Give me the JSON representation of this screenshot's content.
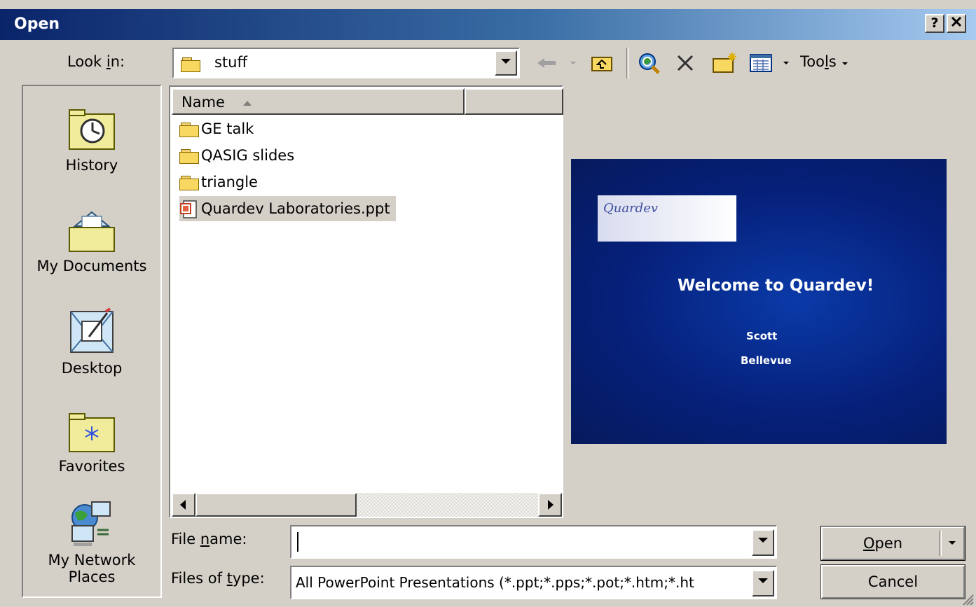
{
  "window": {
    "title": "Open",
    "help_btn": "?",
    "close_btn": "✕"
  },
  "lookin": {
    "label_pre": "Look ",
    "label_key": "i",
    "label_post": "n:",
    "value": "stuff"
  },
  "toolbar": {
    "tools_pre": "Too",
    "tools_key": "l",
    "tools_post": "s"
  },
  "places": [
    {
      "label": "History",
      "icon": "history-icon"
    },
    {
      "label": "My Documents",
      "icon": "my-documents-icon"
    },
    {
      "label": "Desktop",
      "icon": "desktop-icon"
    },
    {
      "label": "Favorites",
      "icon": "favorites-icon"
    },
    {
      "label": "My Network Places",
      "label_line1": "My Network",
      "label_line2": "Places",
      "icon": "network-places-icon"
    }
  ],
  "filelist": {
    "column_name": "Name",
    "items": [
      {
        "name": "GE talk",
        "type": "folder"
      },
      {
        "name": "QASIG slides",
        "type": "folder"
      },
      {
        "name": "triangle",
        "type": "folder"
      },
      {
        "name": "Quardev Laboratories.ppt",
        "type": "ppt",
        "selected": true
      }
    ]
  },
  "preview": {
    "logo_text": "Quardev",
    "title": "Welcome to Quardev!",
    "line1": "Scott",
    "line2": "Bellevue"
  },
  "filename": {
    "label_pre": "File ",
    "label_key": "n",
    "label_post": "ame:",
    "value": ""
  },
  "filetype": {
    "label_pre": "Files of ",
    "label_key": "t",
    "label_post": "ype:",
    "value": "All PowerPoint Presentations (*.ppt;*.pps;*.pot;*.htm;*.ht"
  },
  "buttons": {
    "open_key": "O",
    "open_rest": "pen",
    "cancel": "Cancel"
  },
  "colors": {
    "title_start": "#0a246a",
    "title_end": "#a6caf0",
    "dialog_bg": "#d4d0c8",
    "preview_bg": "#06207a"
  }
}
